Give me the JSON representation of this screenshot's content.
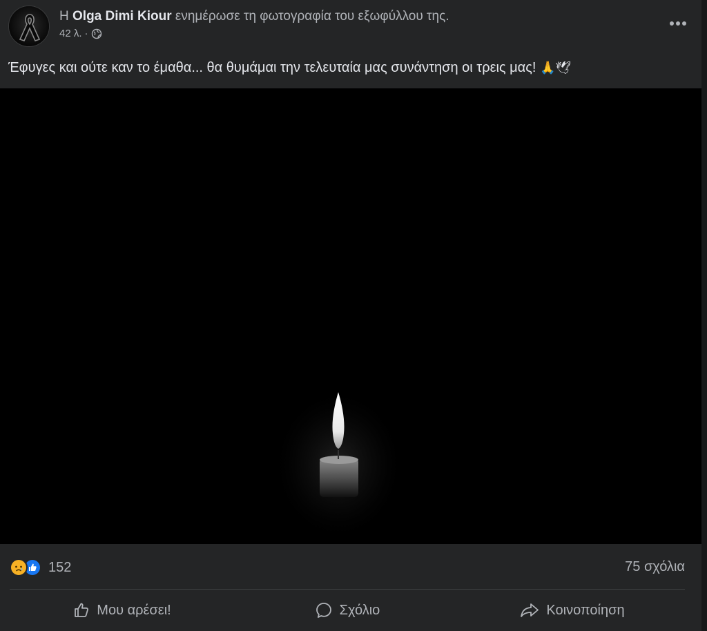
{
  "post": {
    "author_prefix": "Η",
    "author_name": "Olga Dimi Kiour",
    "action_text": "ενημέρωσε τη φωτογραφία του εξωφύλλου της.",
    "timestamp": "42 λ.",
    "separator": "·",
    "privacy_icon": "globe-icon",
    "more_icon": "more-dots-icon",
    "caption_text": "Έφυγες και ούτε καν το έμαθα... θα θυμάμαι την τελευταία μας συνάντηση οι τρεις μας!",
    "caption_emojis": "🙏🕊",
    "image_description_icon": "candle-photo"
  },
  "stats": {
    "reaction_icons": [
      "sad-reaction-icon",
      "like-reaction-icon"
    ],
    "reactions_count": "152",
    "comments_count": "75 σχόλια"
  },
  "actions": {
    "like_label": "Μου αρέσει!",
    "comment_label": "Σχόλιο",
    "share_label": "Κοινοποίηση"
  },
  "colors": {
    "card_bg": "#242526",
    "text_primary": "#e4e6eb",
    "text_secondary": "#b0b3b8",
    "like_blue": "#1877f2",
    "sad_yellow": "#f7b125"
  }
}
